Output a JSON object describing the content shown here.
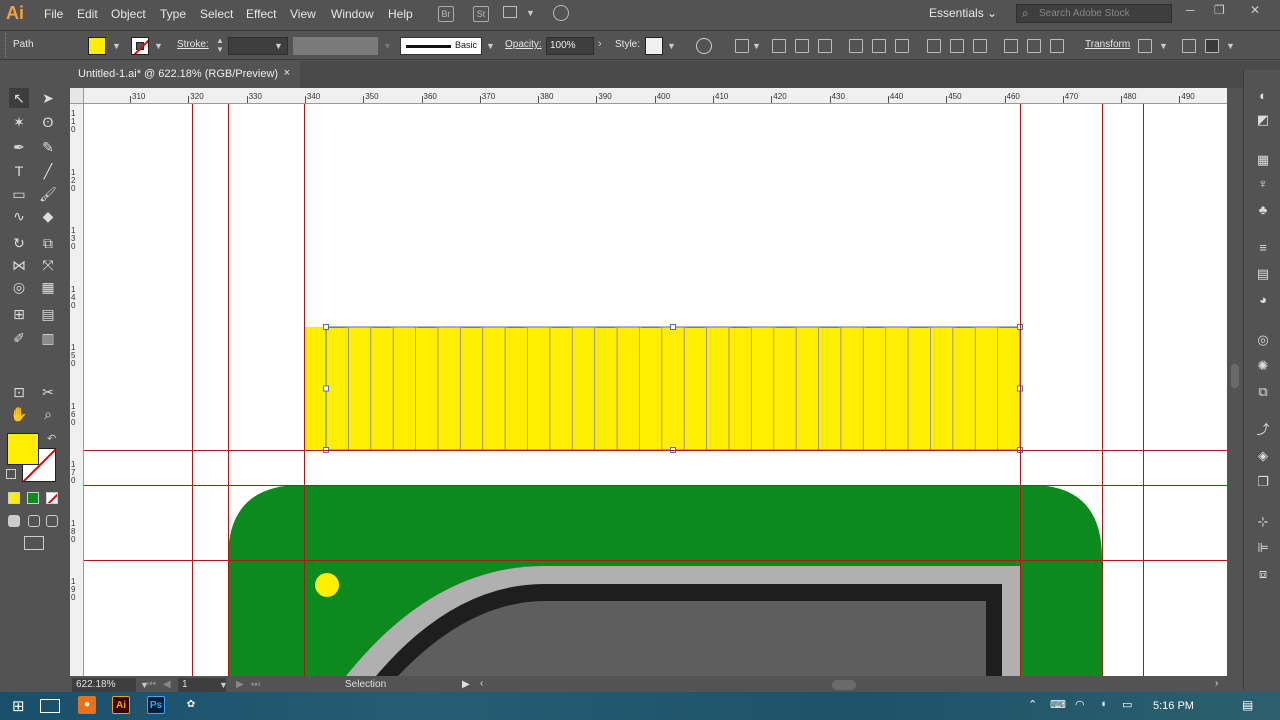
{
  "app": {
    "logo": "Ai"
  },
  "menu": [
    "File",
    "Edit",
    "Object",
    "Type",
    "Select",
    "Effect",
    "View",
    "Window",
    "Help"
  ],
  "menu_icons": {
    "bridge": "Br",
    "stock": "St"
  },
  "workspace": {
    "label": "Essentials",
    "chevron": "⌄"
  },
  "search": {
    "placeholder": "Search Adobe Stock"
  },
  "window_controls": {
    "minimize": "─",
    "restore": "❐",
    "close": "✕"
  },
  "control": {
    "selection_type": "Path",
    "stroke_label": "Stroke:",
    "brush_label": "Basic",
    "opacity_label": "Opacity:",
    "opacity_value": "100%",
    "style_label": "Style:",
    "transform_label": "Transform",
    "fill_color": "#ffee00"
  },
  "tab": {
    "title": "Untitled-1.ai* @ 622.18% (RGB/Preview)",
    "close": "×"
  },
  "ruler": {
    "h_ticks": [
      "310",
      "320",
      "330",
      "340",
      "350",
      "360",
      "370",
      "380",
      "390",
      "400",
      "410",
      "420",
      "430",
      "440",
      "450",
      "460",
      "470",
      "480",
      "490"
    ],
    "v_ticks": [
      "110",
      "120",
      "130",
      "140",
      "150",
      "160",
      "170",
      "180",
      "190"
    ]
  },
  "status": {
    "zoom": "622.18%",
    "artboard": "1",
    "tool": "Selection"
  },
  "taskbar": {
    "time": "5:16 PM",
    "ai": "Ai",
    "ps": "Ps"
  },
  "colors": {
    "fill": "#ffee00",
    "green": "#0d8a1e",
    "guide": "#b01818",
    "selection": "#4a6fd0",
    "grey_light": "#b0b0b0",
    "black": "#1e1e1e",
    "grey_dark": "#5e5e5e"
  }
}
